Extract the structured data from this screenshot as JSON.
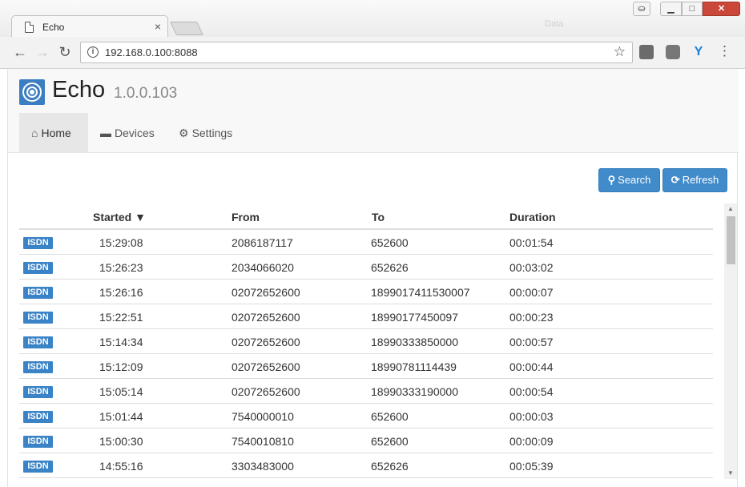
{
  "browser": {
    "tab_title": "Echo",
    "tab_close": "×",
    "ghost_label": "Data",
    "url": "192.168.0.100:8088",
    "window": {
      "minimize": "▁",
      "maximize": "□",
      "close": "✕",
      "user": "⛀"
    }
  },
  "app": {
    "name": "Echo",
    "version": "1.0.0.103",
    "nav": [
      {
        "label": "Home",
        "icon": "home-icon"
      },
      {
        "label": "Devices",
        "icon": "devices-icon"
      },
      {
        "label": "Settings",
        "icon": "gear-icon"
      }
    ],
    "actions": {
      "search": "Search",
      "refresh": "Refresh"
    }
  },
  "calls": {
    "headers": {
      "started": "Started ▼",
      "from": "From",
      "to": "To",
      "duration": "Duration"
    },
    "rows": [
      {
        "type": "ISDN",
        "started": "15:29:08",
        "from": "2086187117",
        "to": "652600",
        "duration": "00:01:54"
      },
      {
        "type": "ISDN",
        "started": "15:26:23",
        "from": "2034066020",
        "to": "652626",
        "duration": "00:03:02"
      },
      {
        "type": "ISDN",
        "started": "15:26:16",
        "from": "02072652600",
        "to": "1899017411530007",
        "duration": "00:00:07"
      },
      {
        "type": "ISDN",
        "started": "15:22:51",
        "from": "02072652600",
        "to": "18990177450097",
        "duration": "00:00:23"
      },
      {
        "type": "ISDN",
        "started": "15:14:34",
        "from": "02072652600",
        "to": "18990333850000",
        "duration": "00:00:57"
      },
      {
        "type": "ISDN",
        "started": "15:12:09",
        "from": "02072652600",
        "to": "18990781114439",
        "duration": "00:00:44"
      },
      {
        "type": "ISDN",
        "started": "15:05:14",
        "from": "02072652600",
        "to": "18990333190000",
        "duration": "00:00:54"
      },
      {
        "type": "ISDN",
        "started": "15:01:44",
        "from": "7540000010",
        "to": "652600",
        "duration": "00:00:03"
      },
      {
        "type": "ISDN",
        "started": "15:00:30",
        "from": "7540010810",
        "to": "652600",
        "duration": "00:00:09"
      },
      {
        "type": "ISDN",
        "started": "14:55:16",
        "from": "3303483000",
        "to": "652626",
        "duration": "00:05:39"
      }
    ]
  },
  "colors": {
    "accent": "#428bca",
    "badge": "#3a83c7",
    "close": "#c9483a"
  }
}
